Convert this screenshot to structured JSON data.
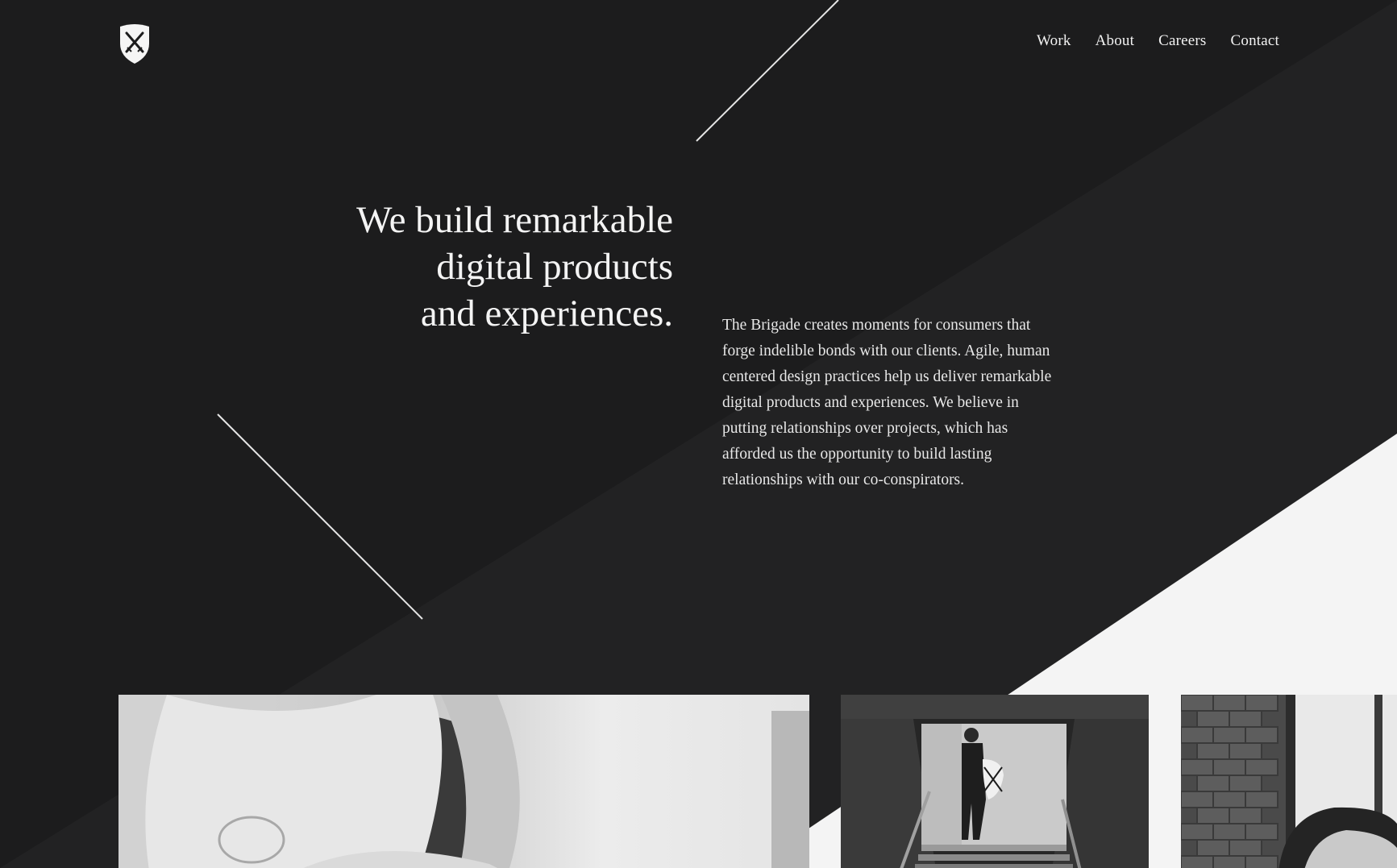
{
  "brand": {
    "logo_icon": "shield-crossed-swords-icon"
  },
  "nav": {
    "items": [
      "Work",
      "About",
      "Careers",
      "Contact"
    ]
  },
  "hero": {
    "headline_lines": [
      "We build remarkable",
      "digital products",
      "and experiences."
    ],
    "intro": "The Brigade creates moments for consumers that forge indelible bonds with our clients. Agile, human centered design practices help us deliver remarkable digital products and experiences. We believe in putting relationships over projects, which has afforded us the opportunity to build lasting relationships with our co-conspirators."
  },
  "photos": [
    {
      "subject": "close-up-arms-photo"
    },
    {
      "subject": "person-with-shield-stairway-photo"
    },
    {
      "subject": "man-brick-wall-photo"
    }
  ],
  "colors": {
    "background": "#1c1c1d",
    "diagonal_shade": "#222223",
    "light_panel": "#f4f4f4",
    "text": "#f2f2f2"
  }
}
